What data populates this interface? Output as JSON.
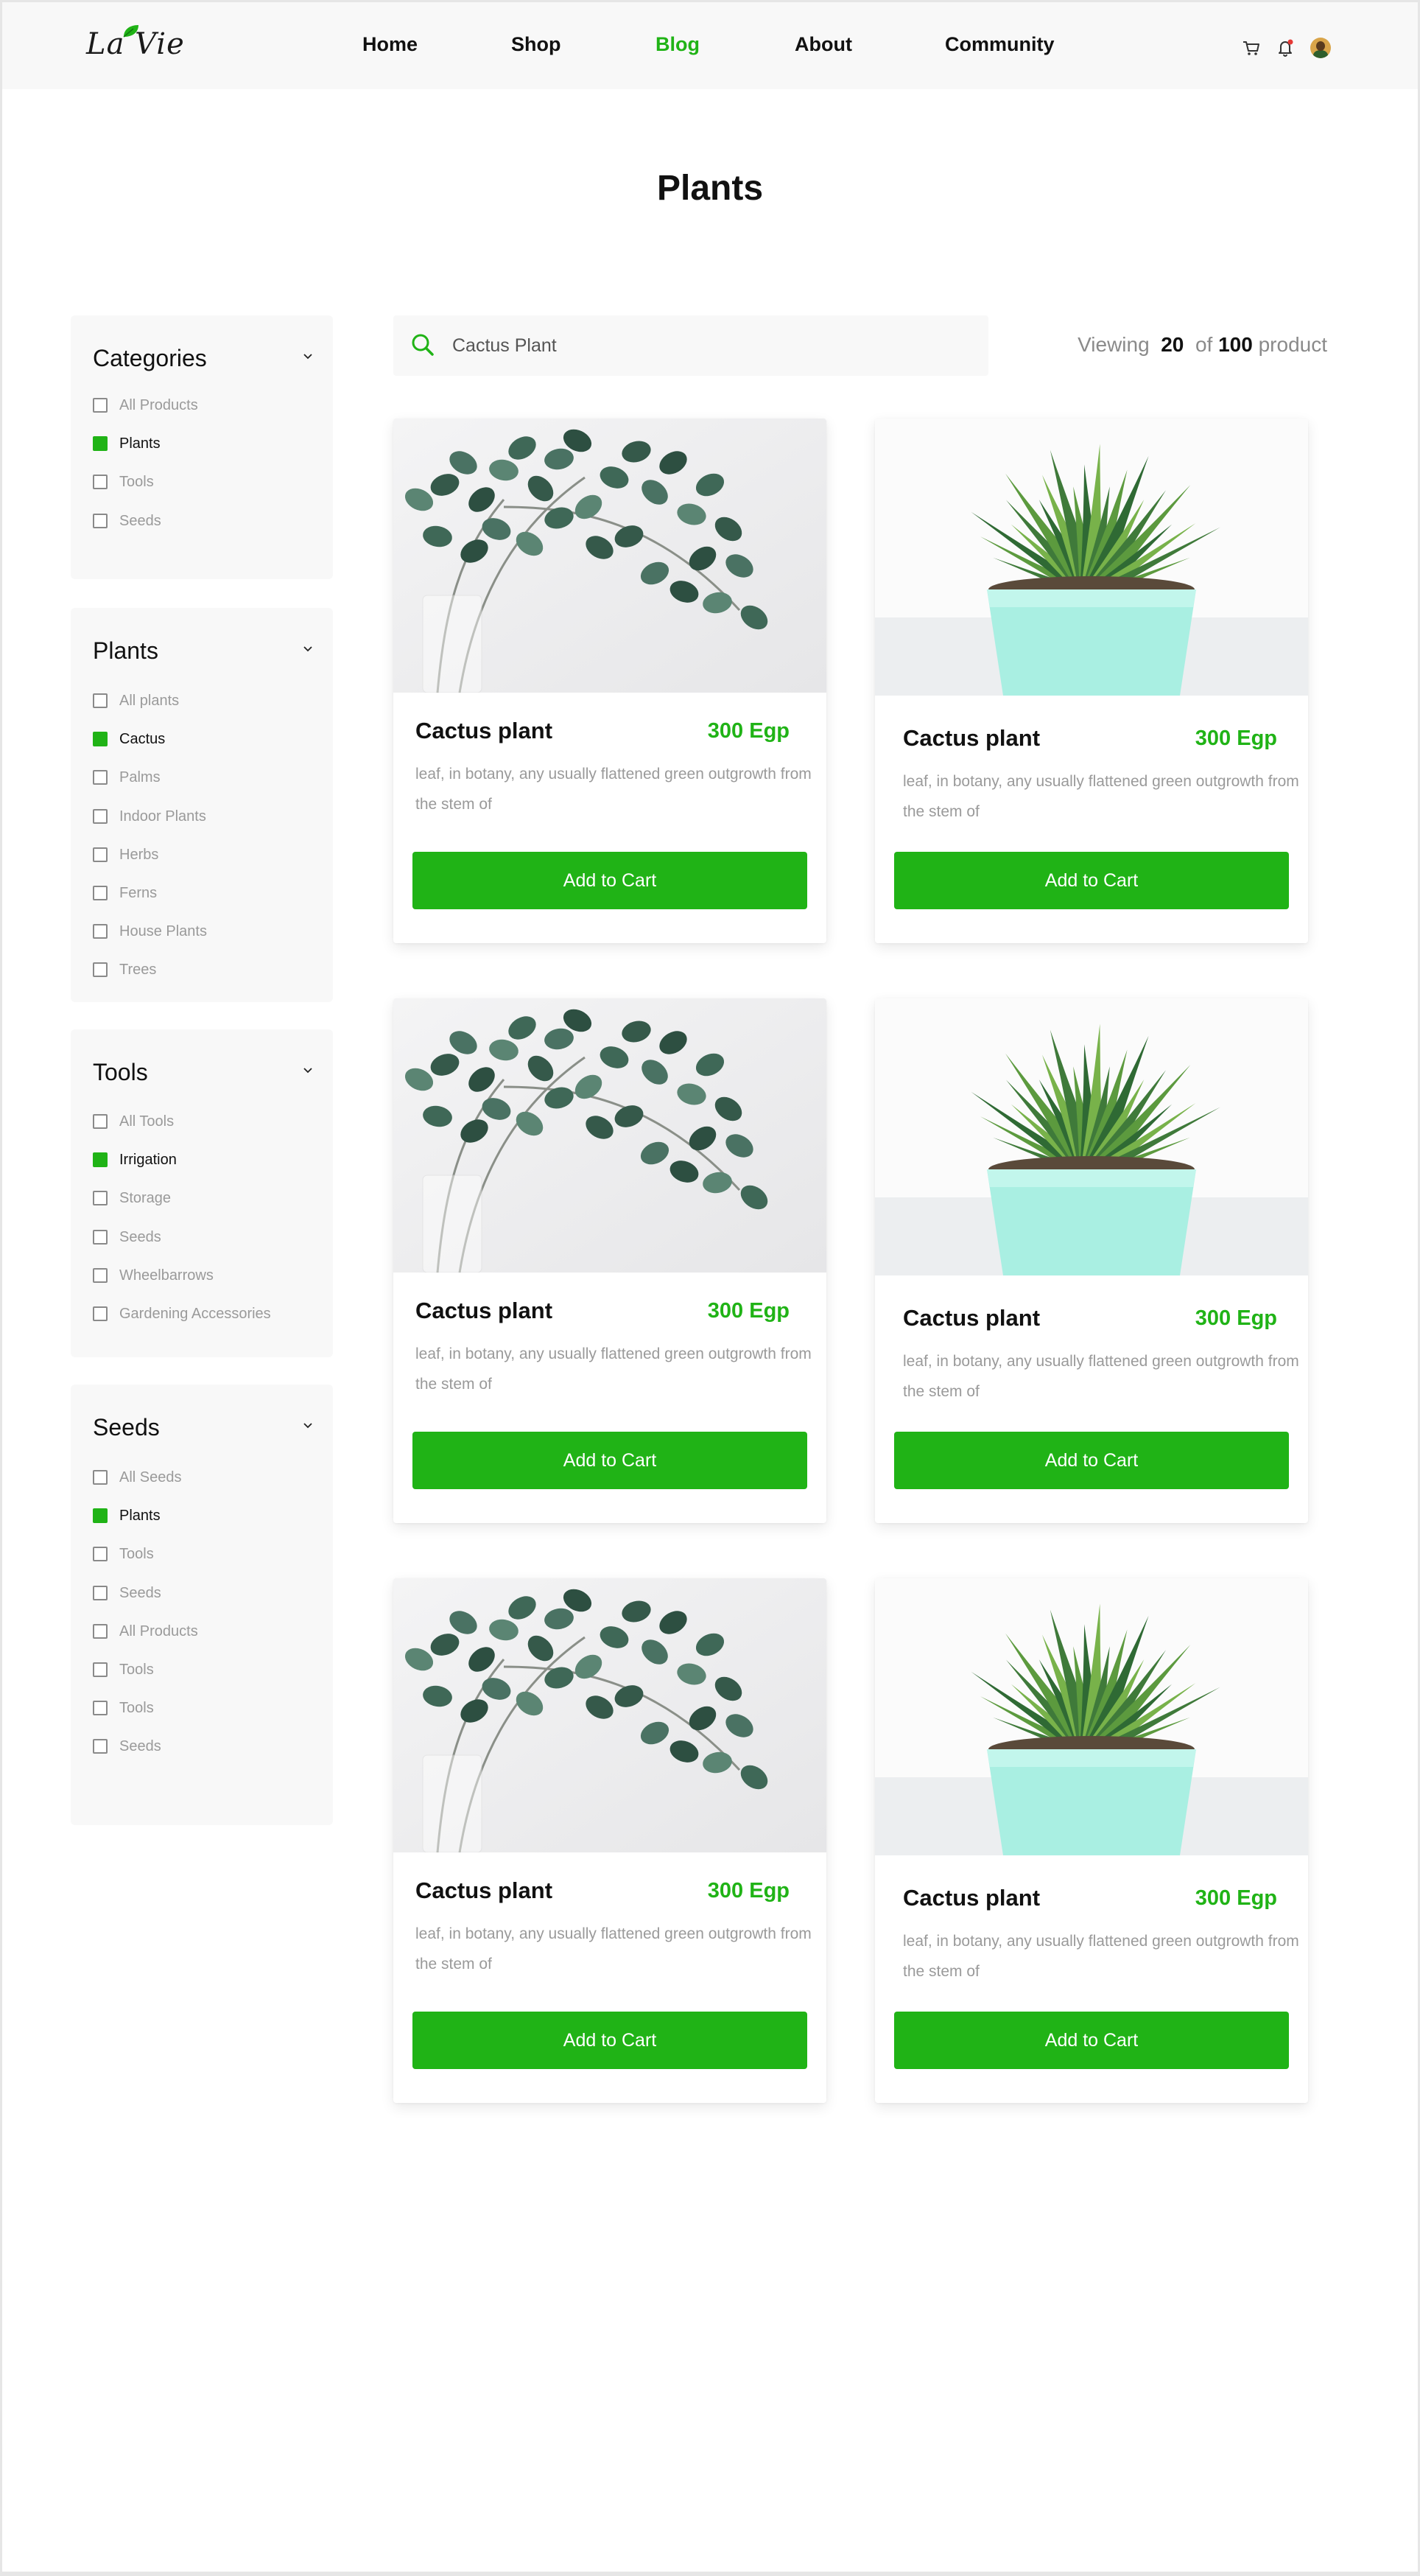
{
  "brand": {
    "logo": "La Vie"
  },
  "nav": [
    {
      "label": "Home",
      "active": false
    },
    {
      "label": "Shop",
      "active": false
    },
    {
      "label": "Blog",
      "active": true
    },
    {
      "label": "About",
      "active": false
    },
    {
      "label": "Community",
      "active": false
    }
  ],
  "header_icons": [
    "cart-icon",
    "bell-icon",
    "avatar"
  ],
  "page": {
    "title": "Plants"
  },
  "search": {
    "value": "Cactus Plant",
    "icon": "search-icon"
  },
  "results": {
    "prefix": "Viewing",
    "shown": "20",
    "of": "of",
    "total": "100",
    "suffix": "product"
  },
  "filters": [
    {
      "title": "Categories",
      "options": [
        {
          "label": "All Products",
          "checked": false
        },
        {
          "label": "Plants",
          "checked": true
        },
        {
          "label": "Tools",
          "checked": false
        },
        {
          "label": "Seeds",
          "checked": false
        }
      ]
    },
    {
      "title": "Plants",
      "options": [
        {
          "label": "All plants",
          "checked": false
        },
        {
          "label": "Cactus",
          "checked": true
        },
        {
          "label": "Palms",
          "checked": false
        },
        {
          "label": "Indoor Plants",
          "checked": false
        },
        {
          "label": "Herbs",
          "checked": false
        },
        {
          "label": "Ferns",
          "checked": false
        },
        {
          "label": "House Plants",
          "checked": false
        },
        {
          "label": "Trees",
          "checked": false
        }
      ]
    },
    {
      "title": "Tools",
      "options": [
        {
          "label": "All Tools",
          "checked": false
        },
        {
          "label": "Irrigation",
          "checked": true
        },
        {
          "label": "Storage",
          "checked": false
        },
        {
          "label": "Seeds",
          "checked": false
        },
        {
          "label": "Wheelbarrows",
          "checked": false
        },
        {
          "label": "Gardening Accessories",
          "checked": false
        }
      ]
    },
    {
      "title": "Seeds",
      "options": [
        {
          "label": "All Seeds",
          "checked": false
        },
        {
          "label": "Plants",
          "checked": true
        },
        {
          "label": "Tools",
          "checked": false
        },
        {
          "label": "Seeds",
          "checked": false
        },
        {
          "label": "All Products",
          "checked": false
        },
        {
          "label": "Tools",
          "checked": false
        },
        {
          "label": "Tools",
          "checked": false
        },
        {
          "label": "Seeds",
          "checked": false
        }
      ]
    }
  ],
  "products": [
    {
      "name": "Cactus plant",
      "price": "300 Egp",
      "description": "leaf, in botany, any usually flattened green outgrowth from the stem of",
      "button": "Add to Cart",
      "image": "eucalyptus-branch"
    },
    {
      "name": "Cactus plant",
      "price": "300 Egp",
      "description": "leaf, in botany, any usually flattened green outgrowth from the stem of",
      "button": "Add to Cart",
      "image": "succulent-in-pot"
    },
    {
      "name": "Cactus plant",
      "price": "300 Egp",
      "description": "leaf, in botany, any usually flattened green outgrowth from the stem of",
      "button": "Add to Cart",
      "image": "eucalyptus-branch"
    },
    {
      "name": "Cactus plant",
      "price": "300 Egp",
      "description": "leaf, in botany, any usually flattened green outgrowth from the stem of",
      "button": "Add to Cart",
      "image": "succulent-in-pot"
    },
    {
      "name": "Cactus plant",
      "price": "300 Egp",
      "description": "leaf, in botany, any usually flattened green outgrowth from the stem of",
      "button": "Add to Cart",
      "image": "eucalyptus-branch"
    },
    {
      "name": "Cactus plant",
      "price": "300 Egp",
      "description": "leaf, in botany, any usually flattened green outgrowth from the stem of",
      "button": "Add to Cart",
      "image": "succulent-in-pot"
    }
  ],
  "colors": {
    "accent": "#20b316",
    "panel": "#f8f8f8",
    "muted_text": "#9a9a9a"
  }
}
